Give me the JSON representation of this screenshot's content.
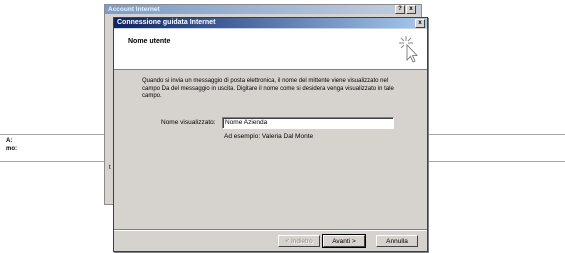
{
  "background": {
    "label_a": "A:",
    "label_b": "mo:"
  },
  "back_window": {
    "title": "Account Internet",
    "help_glyph": "?",
    "close_glyph": "x",
    "side_fragment": "t"
  },
  "wizard": {
    "title": "Connessione guidata Internet",
    "close_glyph": "x",
    "header_title": "Nome utente",
    "description": "Quando si invia un messaggio di posta elettronica, il nome del mittente viene visualizzato nel campo Da del messaggio in uscita. Digitare il nome come si desidera venga visualizzato in tale campo.",
    "display_name_label": "Nome visualizzato:",
    "display_name_value": "Nome Azienda",
    "example": "Ad esempio: Valeria Dal Monte",
    "buttons": {
      "back": "< Indietro",
      "next": "Avanti >",
      "cancel": "Annulla"
    }
  },
  "colors": {
    "titlebar_active": "#0a246a",
    "titlebar_inactive": "#7e9cc6",
    "dialog_face": "#d6d3ce"
  }
}
